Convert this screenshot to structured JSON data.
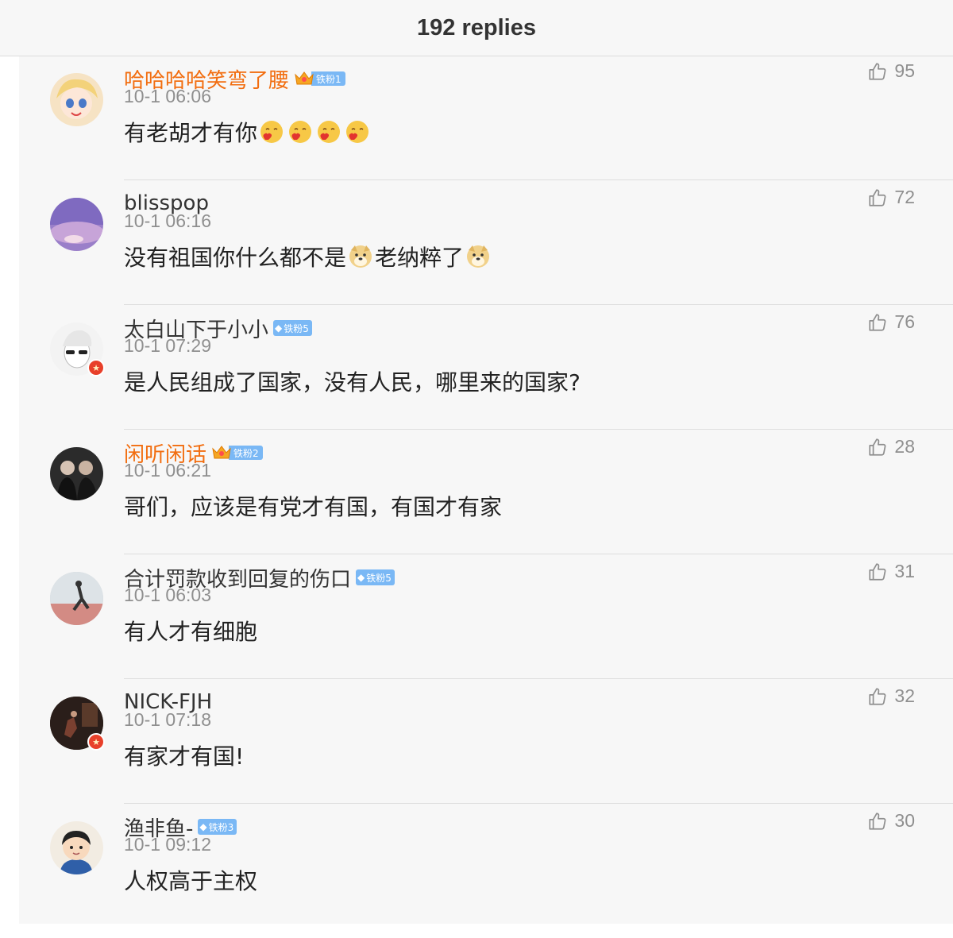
{
  "header": {
    "title": "192 replies"
  },
  "replies": [
    {
      "name": "哈哈哈哈笑弯了腰",
      "vip": true,
      "badge": {
        "kind": "crown",
        "label": "铁粉1"
      },
      "time": "10-1 06:06",
      "text": "有老胡才有你",
      "emojis": [
        "kiss-emoji",
        "kiss-emoji",
        "kiss-emoji",
        "kiss-emoji"
      ],
      "text_after": "",
      "likes": "95",
      "avatar": {
        "style": "anime-girl",
        "bg": "#f6e3c4"
      }
    },
    {
      "name": "blisspop",
      "vip": false,
      "badge": null,
      "time": "10-1 06:16",
      "text": "没有祖国你什么都不是",
      "emojis": [
        "doge-emoji"
      ],
      "text_after": "老纳粹了",
      "emojis_after": [
        "doge-emoji"
      ],
      "likes": "72",
      "avatar": {
        "style": "purple-sky",
        "bg": "#9a7fc9"
      }
    },
    {
      "name": "太白山下于小小",
      "vip": false,
      "badge": {
        "kind": "diamond",
        "label": "铁粉5"
      },
      "time": "10-1 07:29",
      "text": "是人民组成了国家，没有人民，哪里来的国家?",
      "emojis": [],
      "text_after": "",
      "likes": "76",
      "avatar": {
        "style": "sunglasses-sketch",
        "bg": "#f3f3f3"
      },
      "verified": true
    },
    {
      "name": "闲听闲话",
      "vip": true,
      "badge": {
        "kind": "crown",
        "label": "铁粉2"
      },
      "time": "10-1 06:21",
      "text": "哥们，应该是有党才有国，有国才有家",
      "emojis": [],
      "text_after": "",
      "likes": "28",
      "avatar": {
        "style": "dark-photo",
        "bg": "#2b2b2b"
      }
    },
    {
      "name": "合计罚款收到回复的伤口",
      "vip": false,
      "badge": {
        "kind": "diamond",
        "label": "铁粉5"
      },
      "time": "10-1 06:03",
      "text": "有人才有细胞",
      "emojis": [],
      "text_after": "",
      "likes": "31",
      "avatar": {
        "style": "runner-photo",
        "bg": "#c9cfd4"
      }
    },
    {
      "name": "NICK-FJH",
      "vip": false,
      "badge": null,
      "time": "10-1 07:18",
      "text": "有家才有国!",
      "emojis": [],
      "text_after": "",
      "likes": "32",
      "avatar": {
        "style": "night-photo",
        "bg": "#3a2a22"
      },
      "verified": true
    },
    {
      "name": "渔非鱼-",
      "vip": false,
      "badge": {
        "kind": "diamond",
        "label": "铁粉3"
      },
      "time": "10-1 09:12",
      "text": "人权高于主权",
      "emojis": [],
      "text_after": "",
      "likes": "30",
      "avatar": {
        "style": "cartoon-boy",
        "bg": "#f2ece2"
      }
    }
  ],
  "colors": {
    "vip_name": "#f26d0f",
    "fan_badge": "#7ab8f5",
    "muted": "#8f8f8f",
    "verified_badge": "#e8402a"
  },
  "icons": {
    "like": "thumbs-up-icon",
    "diamond": "diamond-icon",
    "crown": "crown-icon"
  }
}
